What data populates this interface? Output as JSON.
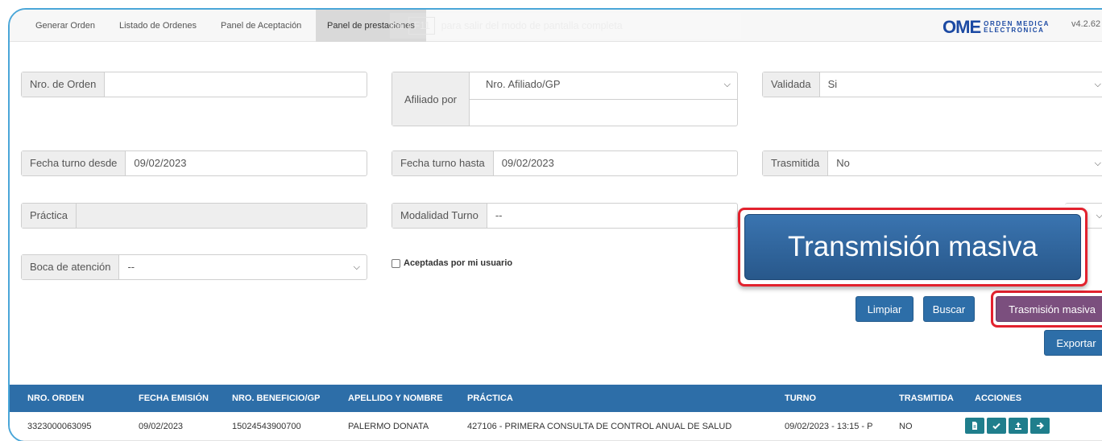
{
  "nav": {
    "tabs": [
      "Generar Orden",
      "Listado de Ordenes",
      "Panel de Aceptación",
      "Panel de prestaciones"
    ],
    "active_tab": "Panel de prestaciones",
    "hint_prefix": "ica",
    "hint_key": "F11",
    "hint_suffix": "para salir del modo de pantalla completa",
    "logo_big": "OME",
    "logo_line1": "ORDEN MEDICA",
    "logo_line2": "ELECTRONICA",
    "version": "v4.2.62"
  },
  "filters": {
    "nro_orden": {
      "label": "Nro. de Orden",
      "value": ""
    },
    "afiliado": {
      "label": "Afiliado por",
      "selected": "Nro. Afiliado/GP",
      "value": ""
    },
    "validada": {
      "label": "Validada",
      "selected": "Si"
    },
    "fecha_desde": {
      "label": "Fecha turno desde",
      "value": "09/02/2023"
    },
    "fecha_hasta": {
      "label": "Fecha turno hasta",
      "value": "09/02/2023"
    },
    "trasmitida": {
      "label": "Trasmitida",
      "selected": "No"
    },
    "practica": {
      "label": "Práctica",
      "value": ""
    },
    "modalidad": {
      "label": "Modalidad Turno",
      "selected": "--"
    },
    "boca": {
      "label": "Boca de atención",
      "selected": "--"
    },
    "aceptadas": {
      "label": "Aceptadas por mi usuario",
      "checked": false
    }
  },
  "buttons": {
    "limpiar": "Limpiar",
    "buscar": "Buscar",
    "trasmision": "Trasmisión masiva",
    "exportar": "Exportar"
  },
  "callout": "Transmisión masiva",
  "table": {
    "headers": [
      "NRO. ORDEN",
      "FECHA EMISIÓN",
      "NRO. BENEFICIO/GP",
      "APELLIDO Y NOMBRE",
      "PRÁCTICA",
      "TURNO",
      "TRASMITIDA",
      "ACCIONES"
    ],
    "rows": [
      [
        "3323000063095",
        "09/02/2023",
        "15024543900700",
        "PALERMO DONATA",
        "427106 - PRIMERA CONSULTA DE CONTROL ANUAL DE SALUD",
        "09/02/2023 - 13:15 - P",
        "NO"
      ]
    ],
    "action_icons": [
      "document-icon",
      "check-icon",
      "upload-icon",
      "arrow-right-icon"
    ]
  }
}
